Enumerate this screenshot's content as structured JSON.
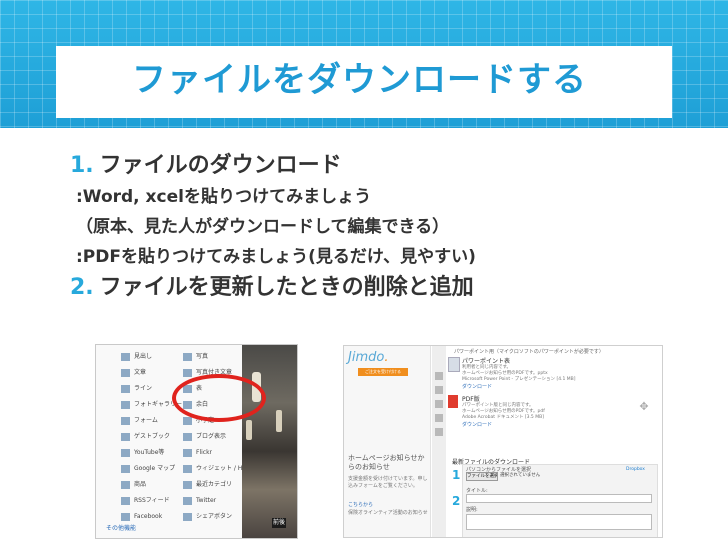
{
  "slide": {
    "title": "ファイルをダウンロードする",
    "colors": {
      "accent": "#27a9dc",
      "title_text": "#1f9ad4",
      "body_text": "#333333",
      "highlight_circle": "#e0231d"
    }
  },
  "bullets": {
    "item1": {
      "number": "1.",
      "text": "ファイルのダウンロード"
    },
    "sub1": ":Word, xcelを貼りつけてみましょう",
    "sub2": "（原本、見た人がダウンロードして編集できる）",
    "sub3": ":PDFを貼りつけてみましょう(見るだけ、見やすい)",
    "item2": {
      "number": "2.",
      "text": "ファイルを更新したときの削除と追加"
    }
  },
  "screenshot_left": {
    "menu": [
      {
        "label": "見出し",
        "icon": "heading-icon"
      },
      {
        "label": "写真",
        "icon": "photo-icon"
      },
      {
        "label": "文章",
        "icon": "text-icon"
      },
      {
        "label": "写真付き文章",
        "icon": "text-photo-icon"
      },
      {
        "label": "ライン",
        "icon": "line-icon"
      },
      {
        "label": "表",
        "icon": "table-icon"
      },
      {
        "label": "フォトギャラリー",
        "icon": "gallery-icon"
      },
      {
        "label": "余白",
        "icon": "spacer-icon"
      },
      {
        "label": "フォーム",
        "icon": "form-icon"
      },
      {
        "label": "小予定",
        "icon": "calendar-icon"
      },
      {
        "label": "ゲストブック",
        "icon": "guestbook-icon"
      },
      {
        "label": "ブログ表示",
        "icon": "blog-icon"
      },
      {
        "label": "YouTube等",
        "icon": "video-icon"
      },
      {
        "label": "Flickr",
        "icon": "flickr-icon"
      },
      {
        "label": "Google マップ",
        "icon": "map-icon"
      },
      {
        "label": "ウィジェット / HTML",
        "icon": "widget-icon"
      },
      {
        "label": "商品",
        "icon": "product-icon"
      },
      {
        "label": "最近カテゴリ",
        "icon": "category-icon"
      },
      {
        "label": "RSSフィード",
        "icon": "rss-icon"
      },
      {
        "label": "Twitter",
        "icon": "twitter-icon"
      },
      {
        "label": "Facebook",
        "icon": "facebook-icon"
      },
      {
        "label": "シェアボタン",
        "icon": "share-icon"
      }
    ],
    "more_link": "その他機能",
    "corner_badge": "前後"
  },
  "screenshot_right": {
    "logo": {
      "text": "Jimdo",
      "dot": "."
    },
    "orange_button": "ご注文を受け付ける",
    "news_title": "ホームページお知らせからのお知らせ",
    "news_text": "支援金額を受け付けています。申し込みフォームをご覧ください。",
    "news_link": "こちらから",
    "news_text2": "保険オラインティア活動のお知らせ",
    "top_note": "パワーポイント用（マイクロソフトのパワーポイントが必要です）",
    "file1": {
      "name": "パワーポイント表",
      "desc1": "利用者と同じ内容です。",
      "desc2": "ホームページお知らせ用のPDFです。pptx",
      "desc3": "Microsoft Power Point - プレゼンテーション [4.1 MB]",
      "link": "ダウンロード"
    },
    "file2": {
      "name": "PDF版",
      "desc1": "パワーポイント版と同じ内容です。",
      "desc2": "ホームページお知らせ用のPDFです。pdf",
      "desc3": "Adobe Acrobat ドキュメント [3.5 MB]",
      "link": "ダウンロード"
    },
    "widget_title": "最新ファイルのダウンロード",
    "step1": "1",
    "step1_label": "パソコンからファイルを選択",
    "choose_button": "ファイルを選択",
    "no_file": "選択されていません",
    "dropbox": "Dropbox",
    "step2": "2",
    "field_label_title": "タイトル:",
    "field_label_desc": "説明:"
  }
}
